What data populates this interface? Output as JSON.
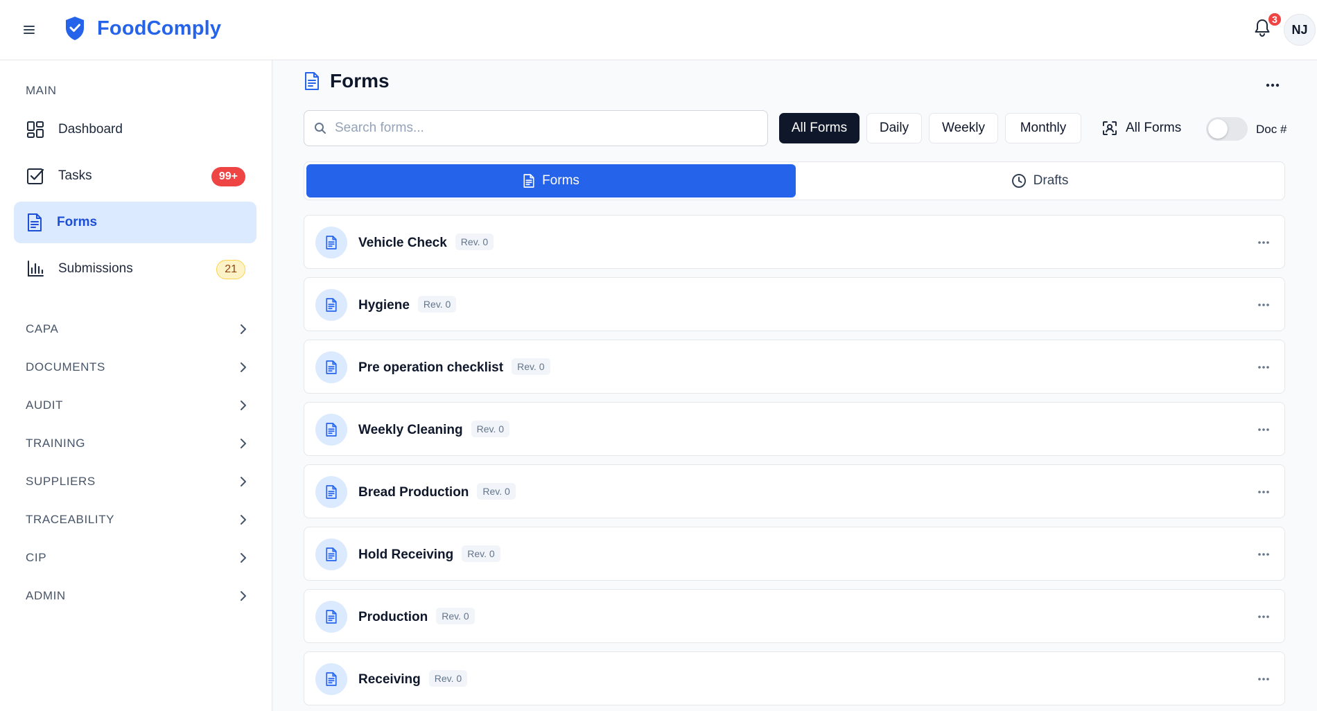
{
  "app": {
    "name": "FoodComply"
  },
  "header": {
    "notification_count": "3",
    "avatar_initials": "NJ"
  },
  "sidebar": {
    "section_label": "MAIN",
    "items": [
      {
        "label": "Dashboard",
        "icon": "dashboard-icon"
      },
      {
        "label": "Tasks",
        "icon": "tasks-icon",
        "badge": "99+"
      },
      {
        "label": "Forms",
        "icon": "forms-icon",
        "active": true
      },
      {
        "label": "Submissions",
        "icon": "chart-icon",
        "badge": "21"
      }
    ],
    "groups": [
      {
        "label": "CAPA"
      },
      {
        "label": "DOCUMENTS"
      },
      {
        "label": "AUDIT"
      },
      {
        "label": "TRAINING"
      },
      {
        "label": "SUPPLIERS"
      },
      {
        "label": "TRACEABILITY"
      },
      {
        "label": "CIP"
      },
      {
        "label": "ADMIN"
      }
    ]
  },
  "page": {
    "title": "Forms"
  },
  "search": {
    "placeholder": "Search forms...",
    "value": ""
  },
  "filters": {
    "frequency": [
      "All Forms",
      "Daily",
      "Weekly",
      "Monthly"
    ],
    "active_frequency": "All Forms",
    "scope_label": "All Forms",
    "toggle_label": "Doc #",
    "toggle_on": false
  },
  "tabs": [
    {
      "label": "Forms",
      "active": true
    },
    {
      "label": "Drafts",
      "active": false
    }
  ],
  "forms": [
    {
      "name": "Vehicle Check",
      "rev": "Rev. 0"
    },
    {
      "name": "Hygiene",
      "rev": "Rev. 0"
    },
    {
      "name": "Pre operation checklist",
      "rev": "Rev. 0"
    },
    {
      "name": "Weekly Cleaning",
      "rev": "Rev. 0"
    },
    {
      "name": "Bread Production",
      "rev": "Rev. 0"
    },
    {
      "name": "Hold Receiving",
      "rev": "Rev. 0"
    },
    {
      "name": "Production",
      "rev": "Rev. 0"
    },
    {
      "name": "Receiving",
      "rev": "Rev. 0"
    }
  ],
  "colors": {
    "brand": "#2563eb",
    "active_nav_bg": "#dbeafe",
    "badge_red": "#ef4444",
    "badge_yellow_bg": "#fef3c7",
    "dark_button": "#0f172a"
  }
}
